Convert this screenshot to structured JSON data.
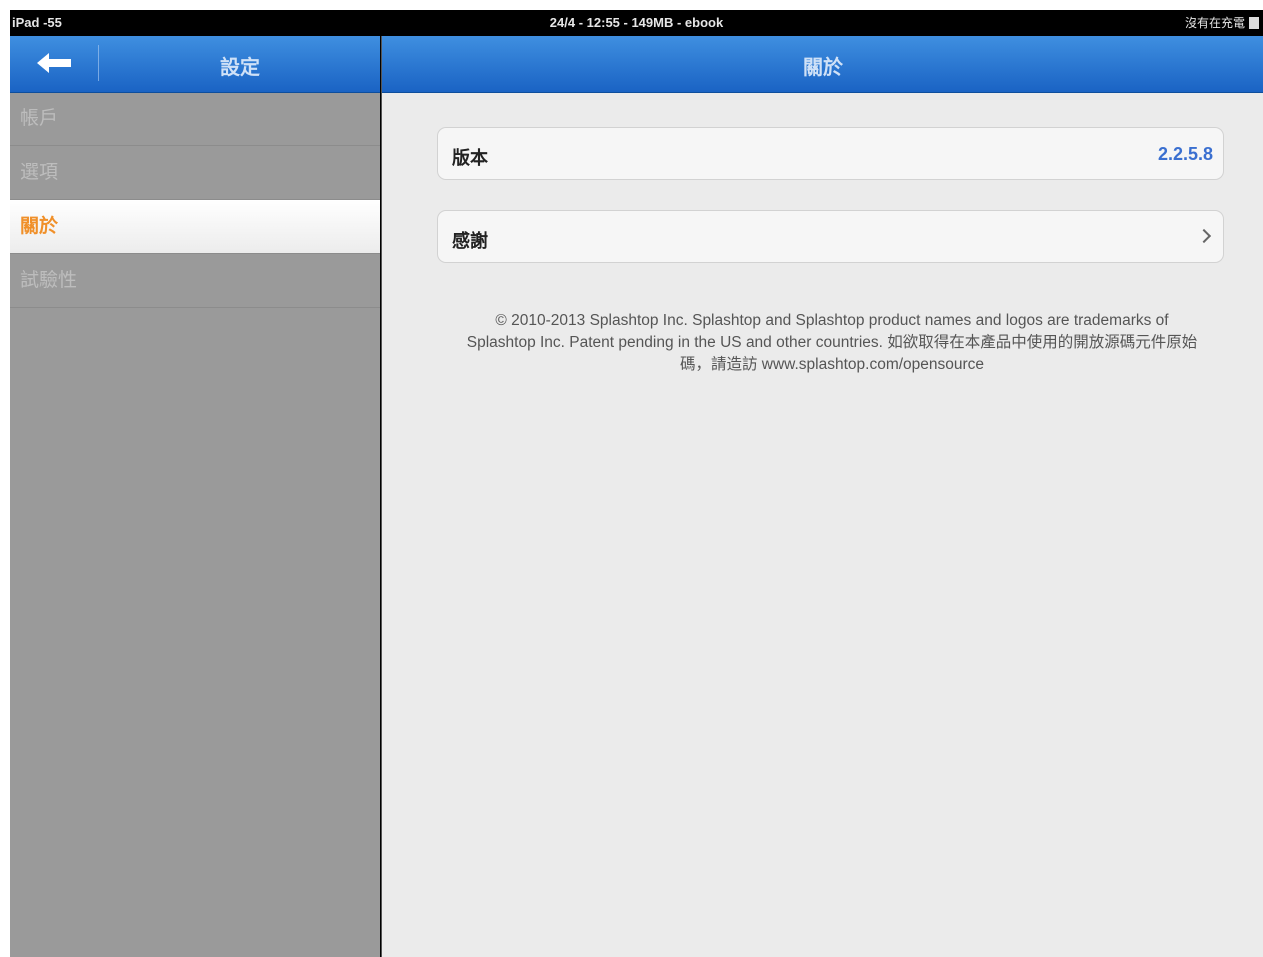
{
  "status_bar": {
    "device": "iPad -55",
    "center": "24/4 - 12:55 - 149MB - ebook",
    "charging": "沒有在充電"
  },
  "sidebar": {
    "title": "設定",
    "items": [
      {
        "label": "帳戶",
        "active": false
      },
      {
        "label": "選項",
        "active": false
      },
      {
        "label": "關於",
        "active": true
      },
      {
        "label": "試驗性",
        "active": false
      }
    ]
  },
  "detail": {
    "title": "關於",
    "version_label": "版本",
    "version_value": "2.2.5.8",
    "thanks_label": "感謝",
    "copyright": "© 2010-2013 Splashtop Inc. Splashtop and Splashtop product names and logos are trademarks of Splashtop Inc. Patent pending in the US and other countries. 如欲取得在本產品中使用的開放源碼元件原始碼，請造訪 www.splashtop.com/opensource"
  },
  "colors": {
    "nav_blue": "#1a63c4",
    "active_orange": "#f0902a",
    "version_blue": "#3a6fd0"
  },
  "icons": {
    "back": "back-arrow-icon",
    "disclosure": "chevron-right-icon",
    "battery": "battery-icon"
  }
}
